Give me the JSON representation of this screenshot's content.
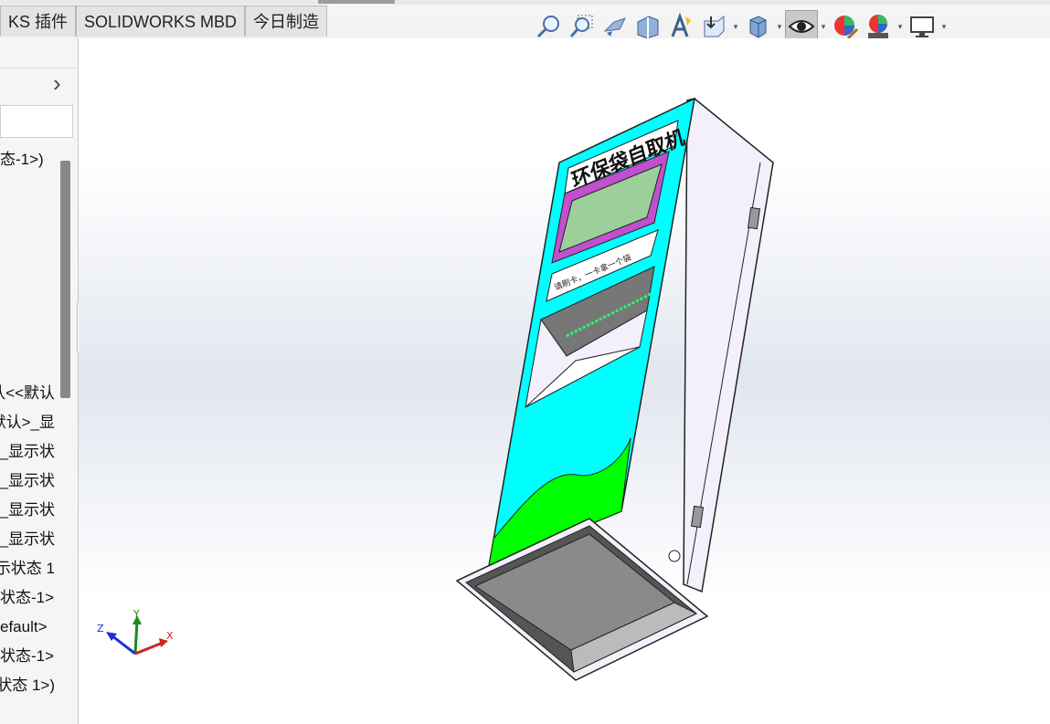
{
  "ribbon": {
    "tabs": [
      "KS 插件",
      "SOLIDWORKS MBD",
      "今日制造"
    ]
  },
  "toolbar": {
    "icons": [
      "zoom-to-fit-icon",
      "zoom-area-icon",
      "previous-view-icon",
      "section-view-icon",
      "dynamic-annotation-icon",
      "view-orientation-icon",
      "display-style-icon",
      "hide-show-items-icon",
      "edit-appearance-icon",
      "apply-scene-icon",
      "view-settings-icon"
    ]
  },
  "feature_tree": {
    "items": [
      "态-1>)",
      "认<<默认",
      "默认>_显",
      "_显示状",
      "_显示状",
      "_显示状",
      "_显示状",
      "示状态 1",
      "状态-1>",
      "efault>",
      "状态-1>",
      "状态 1>)"
    ]
  },
  "model": {
    "title": "环保袋自取机",
    "sign_text": "请刷卡，一卡拿一个袋"
  },
  "triad": {
    "x": "X",
    "y": "Y",
    "z": "Z"
  },
  "colors": {
    "cyan_panel": "#00ffff",
    "green_panel": "#00ff00",
    "screen": "#9dcf9a",
    "screen_frame": "#c050d0",
    "body": "#f4f0fb"
  }
}
